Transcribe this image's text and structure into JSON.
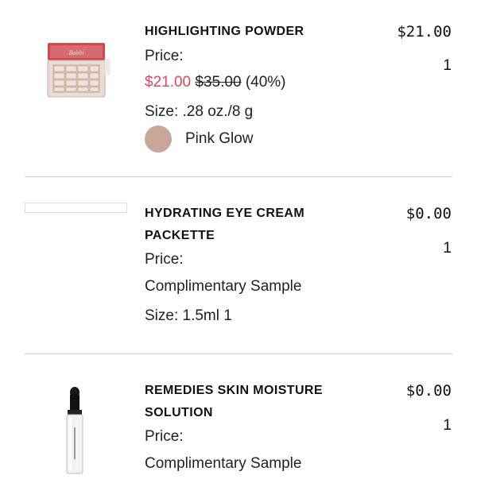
{
  "items": [
    {
      "name": "HIGHLIGHTING POWDER",
      "price_label": "Price:",
      "sale_price": "$21.00",
      "original_price": "$35.00",
      "discount": "(40%)",
      "size": "Size: .28 oz./8 g",
      "shade": "Pink Glow",
      "shade_color": "#c9a69a",
      "total": "$21.00",
      "quantity": "1"
    },
    {
      "name_line1": "HYDRATING EYE CREAM",
      "name_line2": "PACKETTE",
      "price_label": "Price:",
      "price_text": "Complimentary Sample",
      "size": "Size: 1.5ml 1",
      "total": "$0.00",
      "quantity": "1"
    },
    {
      "name_line1": "REMEDIES SKIN MOISTURE",
      "name_line2": "SOLUTION",
      "price_label": "Price:",
      "price_text": "Complimentary Sample",
      "total": "$0.00",
      "quantity": "1"
    }
  ]
}
